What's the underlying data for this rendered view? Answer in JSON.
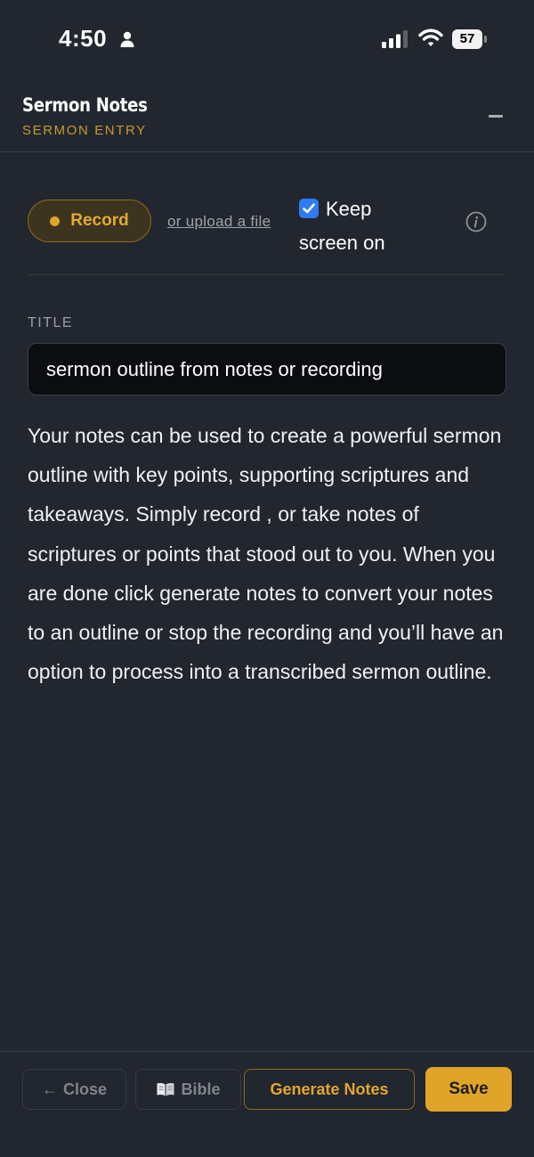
{
  "status_bar": {
    "time": "4:50",
    "battery": "57"
  },
  "header": {
    "title": "Sermon Notes",
    "subtitle": "SERMON ENTRY"
  },
  "record": {
    "record_label": "Record",
    "upload_link": "or upload a file",
    "keep_screen_label": "Keep screen on",
    "keep_screen_checked": true
  },
  "title_section": {
    "label": "TITLE",
    "placeholder": "sermon outline from notes or recording",
    "value": ""
  },
  "description": "Your notes can be used to create a powerful sermon outline with key points, supporting scriptures and takeaways. Simply record , or take notes of scriptures or points that stood out to you. When you are done click generate notes to convert your notes to an outline or stop the recording and you’ll have an option to process into a transcribed sermon outline.",
  "footer": {
    "close_label": "Close",
    "bible_label": "Bible",
    "generate_label": "Generate Notes",
    "save_label": "Save"
  },
  "icons": {
    "close": "arrow-left-icon",
    "bible": "book-icon",
    "info": "info-icon"
  },
  "colors": {
    "background": "#22262e",
    "accent": "#e0a428",
    "checkbox": "#2f7bf5"
  }
}
